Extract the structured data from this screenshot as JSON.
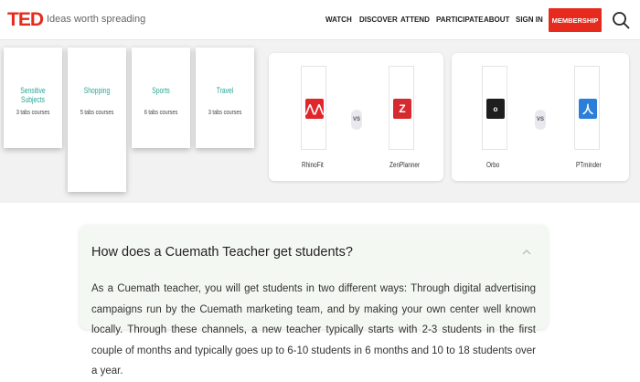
{
  "header": {
    "logo": "TED",
    "tagline": "Ideas worth spreading",
    "nav": [
      "WATCH",
      "DISCOVER",
      "ATTEND",
      "PARTICIPATE",
      "ABOUT",
      "SIGN IN"
    ],
    "membership": "MEMBERSHIP",
    "search_icon": "search-icon"
  },
  "categories": [
    {
      "title": "Sensitive Subjects",
      "sub": "3 tabs courses"
    },
    {
      "title": "Shopping",
      "sub": "5 tabs courses"
    },
    {
      "title": "Sports",
      "sub": "6 tabs courses"
    },
    {
      "title": "Travel",
      "sub": "3 tabs courses"
    }
  ],
  "comparisons": [
    {
      "left": {
        "name": "RhinoFit",
        "color": "#e0262b",
        "glyph": "⋀⋀"
      },
      "vs": "VS",
      "right": {
        "name": "ZenPlanner",
        "color": "#d42a30",
        "glyph": "Z"
      }
    },
    {
      "left": {
        "name": "Orbo",
        "color": "#1e1e1e",
        "glyph": "o"
      },
      "vs": "VS",
      "right": {
        "name": "PTminder",
        "color": "#2b7fd8",
        "glyph": "人"
      }
    }
  ],
  "faq": {
    "question": "How does a Cuemath Teacher get students?",
    "answer": "As a Cuemath teacher, you will get students in two different ways: Through digital advertising campaigns run by the Cuemath marketing team, and by making your own center well known locally. Through these channels, a new teacher typically starts with 2-3 students in the first couple of months and typically goes up to 6-10 students in 6 months and 10 to 18 students over a year."
  }
}
